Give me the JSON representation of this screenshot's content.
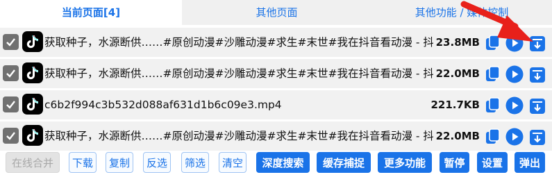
{
  "tabs": [
    {
      "label": "当前页面[4]",
      "active": true
    },
    {
      "label": "其他页面",
      "active": false
    },
    {
      "label": "其他功能 / 媒体控制",
      "active": false
    }
  ],
  "rows": [
    {
      "checked": true,
      "icon": "tiktok-logo",
      "name": "获取种子，水源断供……#原创动漫#沙雕动漫#求生#末世#我在抖音看动漫 - 抖音",
      "size": "23.8MB"
    },
    {
      "checked": true,
      "icon": "tiktok-logo",
      "name": "获取种子，水源断供……#原创动漫#沙雕动漫#求生#末世#我在抖音看动漫 - 抖音",
      "size": "22.0MB"
    },
    {
      "checked": true,
      "icon": "tiktok-logo",
      "name": "c6b2f994c3b532d088af631d1b6c09e3.mp4",
      "size": "221.7KB"
    },
    {
      "checked": true,
      "icon": "tiktok-logo",
      "name": "获取种子，水源断供……#原创动漫#沙雕动漫#求生#末世#我在抖音看动漫 - 抖音",
      "size": "22.0MB"
    }
  ],
  "toolbar": {
    "merge": "在线合并",
    "download": "下载",
    "copy": "复制",
    "invert": "反选",
    "filter": "筛选",
    "clear": "清空",
    "deep_search": "深度搜索",
    "cache_capture": "缓存捕捉",
    "more": "更多功能",
    "pause": "暂停",
    "settings": "设置",
    "popout": "弹出"
  },
  "colors": {
    "accent": "#1a73e8",
    "row_bg": "#f1f1f1",
    "checkbox": "#707070",
    "annotation": "#e8201a"
  }
}
